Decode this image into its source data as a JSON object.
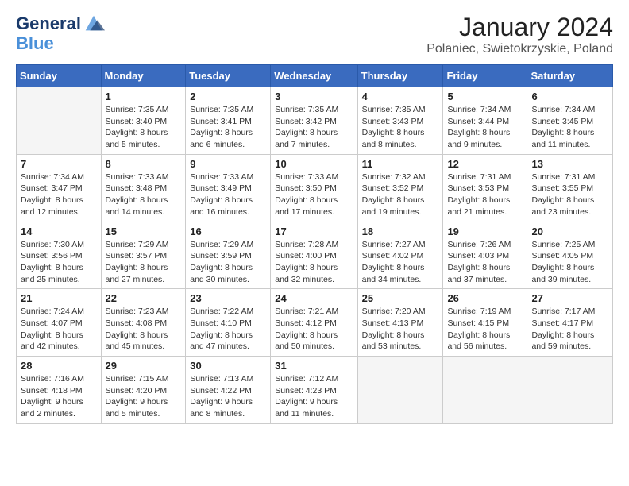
{
  "logo": {
    "text_general": "General",
    "text_blue": "Blue"
  },
  "title": "January 2024",
  "subtitle": "Polaniec, Swietokrzyskie, Poland",
  "days_header": [
    "Sunday",
    "Monday",
    "Tuesday",
    "Wednesday",
    "Thursday",
    "Friday",
    "Saturday"
  ],
  "weeks": [
    [
      {
        "day": "",
        "sunrise": "",
        "sunset": "",
        "daylight": ""
      },
      {
        "day": "1",
        "sunrise": "Sunrise: 7:35 AM",
        "sunset": "Sunset: 3:40 PM",
        "daylight": "Daylight: 8 hours and 5 minutes."
      },
      {
        "day": "2",
        "sunrise": "Sunrise: 7:35 AM",
        "sunset": "Sunset: 3:41 PM",
        "daylight": "Daylight: 8 hours and 6 minutes."
      },
      {
        "day": "3",
        "sunrise": "Sunrise: 7:35 AM",
        "sunset": "Sunset: 3:42 PM",
        "daylight": "Daylight: 8 hours and 7 minutes."
      },
      {
        "day": "4",
        "sunrise": "Sunrise: 7:35 AM",
        "sunset": "Sunset: 3:43 PM",
        "daylight": "Daylight: 8 hours and 8 minutes."
      },
      {
        "day": "5",
        "sunrise": "Sunrise: 7:34 AM",
        "sunset": "Sunset: 3:44 PM",
        "daylight": "Daylight: 8 hours and 9 minutes."
      },
      {
        "day": "6",
        "sunrise": "Sunrise: 7:34 AM",
        "sunset": "Sunset: 3:45 PM",
        "daylight": "Daylight: 8 hours and 11 minutes."
      }
    ],
    [
      {
        "day": "7",
        "sunrise": "Sunrise: 7:34 AM",
        "sunset": "Sunset: 3:47 PM",
        "daylight": "Daylight: 8 hours and 12 minutes."
      },
      {
        "day": "8",
        "sunrise": "Sunrise: 7:33 AM",
        "sunset": "Sunset: 3:48 PM",
        "daylight": "Daylight: 8 hours and 14 minutes."
      },
      {
        "day": "9",
        "sunrise": "Sunrise: 7:33 AM",
        "sunset": "Sunset: 3:49 PM",
        "daylight": "Daylight: 8 hours and 16 minutes."
      },
      {
        "day": "10",
        "sunrise": "Sunrise: 7:33 AM",
        "sunset": "Sunset: 3:50 PM",
        "daylight": "Daylight: 8 hours and 17 minutes."
      },
      {
        "day": "11",
        "sunrise": "Sunrise: 7:32 AM",
        "sunset": "Sunset: 3:52 PM",
        "daylight": "Daylight: 8 hours and 19 minutes."
      },
      {
        "day": "12",
        "sunrise": "Sunrise: 7:31 AM",
        "sunset": "Sunset: 3:53 PM",
        "daylight": "Daylight: 8 hours and 21 minutes."
      },
      {
        "day": "13",
        "sunrise": "Sunrise: 7:31 AM",
        "sunset": "Sunset: 3:55 PM",
        "daylight": "Daylight: 8 hours and 23 minutes."
      }
    ],
    [
      {
        "day": "14",
        "sunrise": "Sunrise: 7:30 AM",
        "sunset": "Sunset: 3:56 PM",
        "daylight": "Daylight: 8 hours and 25 minutes."
      },
      {
        "day": "15",
        "sunrise": "Sunrise: 7:29 AM",
        "sunset": "Sunset: 3:57 PM",
        "daylight": "Daylight: 8 hours and 27 minutes."
      },
      {
        "day": "16",
        "sunrise": "Sunrise: 7:29 AM",
        "sunset": "Sunset: 3:59 PM",
        "daylight": "Daylight: 8 hours and 30 minutes."
      },
      {
        "day": "17",
        "sunrise": "Sunrise: 7:28 AM",
        "sunset": "Sunset: 4:00 PM",
        "daylight": "Daylight: 8 hours and 32 minutes."
      },
      {
        "day": "18",
        "sunrise": "Sunrise: 7:27 AM",
        "sunset": "Sunset: 4:02 PM",
        "daylight": "Daylight: 8 hours and 34 minutes."
      },
      {
        "day": "19",
        "sunrise": "Sunrise: 7:26 AM",
        "sunset": "Sunset: 4:03 PM",
        "daylight": "Daylight: 8 hours and 37 minutes."
      },
      {
        "day": "20",
        "sunrise": "Sunrise: 7:25 AM",
        "sunset": "Sunset: 4:05 PM",
        "daylight": "Daylight: 8 hours and 39 minutes."
      }
    ],
    [
      {
        "day": "21",
        "sunrise": "Sunrise: 7:24 AM",
        "sunset": "Sunset: 4:07 PM",
        "daylight": "Daylight: 8 hours and 42 minutes."
      },
      {
        "day": "22",
        "sunrise": "Sunrise: 7:23 AM",
        "sunset": "Sunset: 4:08 PM",
        "daylight": "Daylight: 8 hours and 45 minutes."
      },
      {
        "day": "23",
        "sunrise": "Sunrise: 7:22 AM",
        "sunset": "Sunset: 4:10 PM",
        "daylight": "Daylight: 8 hours and 47 minutes."
      },
      {
        "day": "24",
        "sunrise": "Sunrise: 7:21 AM",
        "sunset": "Sunset: 4:12 PM",
        "daylight": "Daylight: 8 hours and 50 minutes."
      },
      {
        "day": "25",
        "sunrise": "Sunrise: 7:20 AM",
        "sunset": "Sunset: 4:13 PM",
        "daylight": "Daylight: 8 hours and 53 minutes."
      },
      {
        "day": "26",
        "sunrise": "Sunrise: 7:19 AM",
        "sunset": "Sunset: 4:15 PM",
        "daylight": "Daylight: 8 hours and 56 minutes."
      },
      {
        "day": "27",
        "sunrise": "Sunrise: 7:17 AM",
        "sunset": "Sunset: 4:17 PM",
        "daylight": "Daylight: 8 hours and 59 minutes."
      }
    ],
    [
      {
        "day": "28",
        "sunrise": "Sunrise: 7:16 AM",
        "sunset": "Sunset: 4:18 PM",
        "daylight": "Daylight: 9 hours and 2 minutes."
      },
      {
        "day": "29",
        "sunrise": "Sunrise: 7:15 AM",
        "sunset": "Sunset: 4:20 PM",
        "daylight": "Daylight: 9 hours and 5 minutes."
      },
      {
        "day": "30",
        "sunrise": "Sunrise: 7:13 AM",
        "sunset": "Sunset: 4:22 PM",
        "daylight": "Daylight: 9 hours and 8 minutes."
      },
      {
        "day": "31",
        "sunrise": "Sunrise: 7:12 AM",
        "sunset": "Sunset: 4:23 PM",
        "daylight": "Daylight: 9 hours and 11 minutes."
      },
      {
        "day": "",
        "sunrise": "",
        "sunset": "",
        "daylight": ""
      },
      {
        "day": "",
        "sunrise": "",
        "sunset": "",
        "daylight": ""
      },
      {
        "day": "",
        "sunrise": "",
        "sunset": "",
        "daylight": ""
      }
    ]
  ]
}
